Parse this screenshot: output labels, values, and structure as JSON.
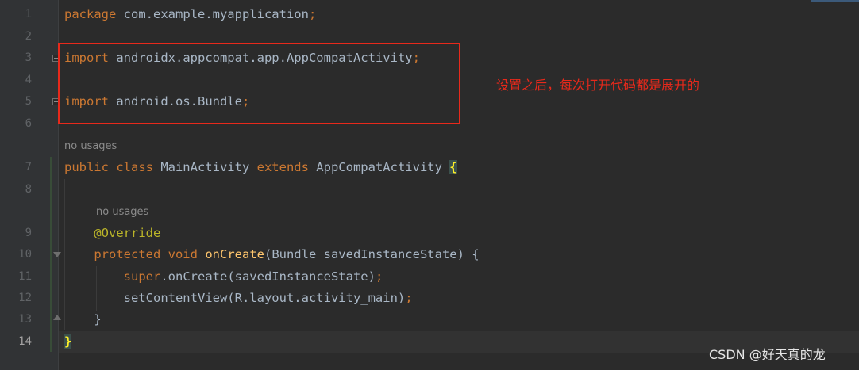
{
  "editor": {
    "lines": [
      {
        "number": "1",
        "tokens": [
          {
            "t": "package",
            "c": "kw"
          },
          {
            "t": " com.example.myapplication",
            "c": ""
          },
          {
            "t": ";",
            "c": "punct"
          }
        ]
      },
      {
        "number": "2",
        "tokens": []
      },
      {
        "number": "3",
        "tokens": [
          {
            "t": "import",
            "c": "kw"
          },
          {
            "t": " androidx.appcompat.app.AppCompatActivity",
            "c": ""
          },
          {
            "t": ";",
            "c": "punct"
          }
        ]
      },
      {
        "number": "4",
        "tokens": []
      },
      {
        "number": "5",
        "tokens": [
          {
            "t": "import",
            "c": "kw"
          },
          {
            "t": " android.os.Bundle",
            "c": ""
          },
          {
            "t": ";",
            "c": "punct"
          }
        ]
      },
      {
        "number": "6",
        "tokens": []
      },
      {
        "number": "7",
        "tokens": [
          {
            "t": "public class",
            "c": "kw"
          },
          {
            "t": " MainActivity ",
            "c": ""
          },
          {
            "t": "extends",
            "c": "kw"
          },
          {
            "t": " AppCompatActivity ",
            "c": ""
          },
          {
            "t": "{",
            "c": "brace-hl"
          }
        ]
      },
      {
        "number": "8",
        "tokens": []
      },
      {
        "number": "9",
        "tokens": [
          {
            "t": "    ",
            "c": ""
          },
          {
            "t": "@Override",
            "c": "ann"
          }
        ]
      },
      {
        "number": "10",
        "tokens": [
          {
            "t": "    ",
            "c": ""
          },
          {
            "t": "protected void",
            "c": "kw"
          },
          {
            "t": " ",
            "c": ""
          },
          {
            "t": "onCreate",
            "c": "fn"
          },
          {
            "t": "(Bundle savedInstanceState) {",
            "c": ""
          }
        ]
      },
      {
        "number": "11",
        "tokens": [
          {
            "t": "        ",
            "c": ""
          },
          {
            "t": "super",
            "c": "kw"
          },
          {
            "t": ".onCreate(savedInstanceState)",
            "c": ""
          },
          {
            "t": ";",
            "c": "punct"
          }
        ]
      },
      {
        "number": "12",
        "tokens": [
          {
            "t": "        setContentView(R.layout.activity_main)",
            "c": ""
          },
          {
            "t": ";",
            "c": "punct"
          }
        ]
      },
      {
        "number": "13",
        "tokens": [
          {
            "t": "    }",
            "c": ""
          }
        ]
      },
      {
        "number": "14",
        "tokens": [
          {
            "t": "}",
            "c": "brace-hl"
          }
        ]
      }
    ],
    "usage_hint": "no usages",
    "current_line": "14"
  },
  "annotation": {
    "note": "设置之后，每次打开代码都是展开的",
    "color": "#e8291b"
  },
  "watermark": "CSDN @好天真的龙",
  "colors": {
    "background": "#2b2b2b",
    "keyword": "#cc7832",
    "identifier": "#a9b7c6",
    "method": "#ffc66d",
    "annotation": "#bbb529",
    "line_number": "#606366"
  }
}
